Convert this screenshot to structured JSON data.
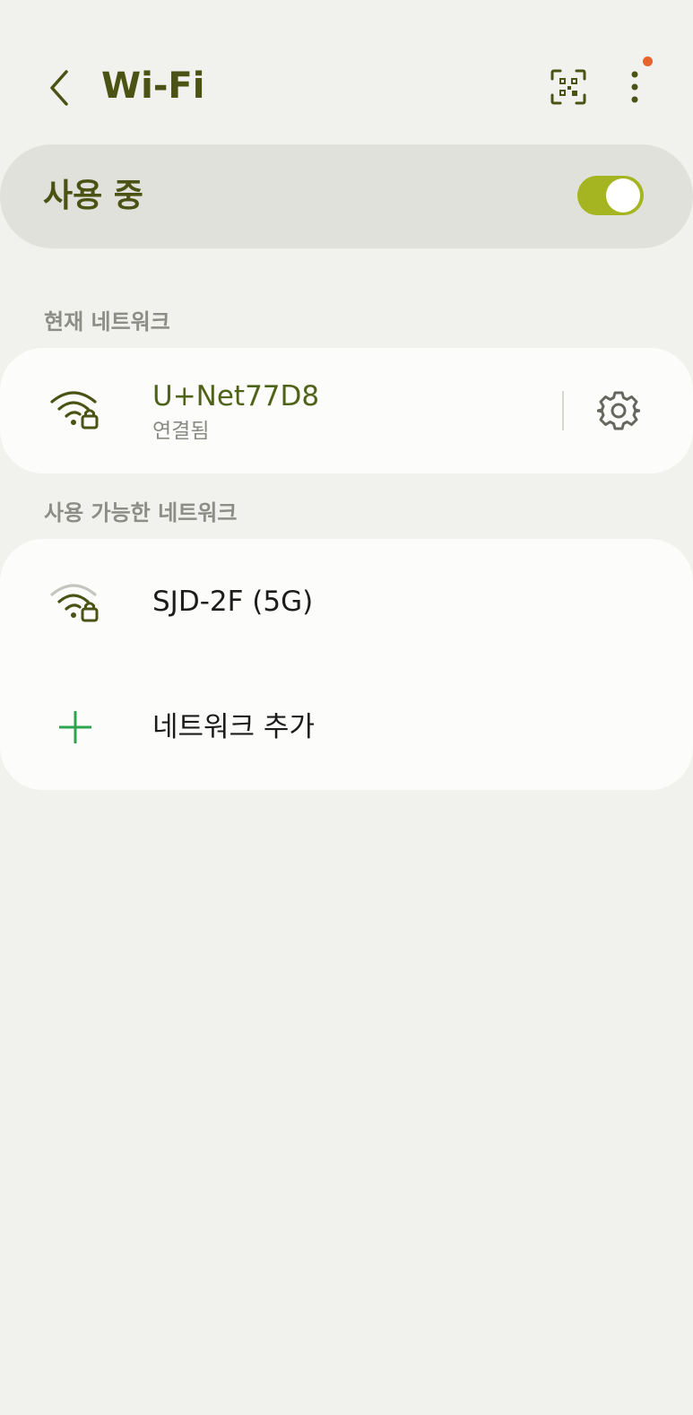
{
  "header": {
    "title": "Wi-Fi",
    "back_icon": "chevron-left-icon",
    "qr_icon": "qr-code-scan-icon",
    "more_icon": "more-vertical-icon",
    "notification_dot_color": "#e8622c"
  },
  "master_switch": {
    "label": "사용 중",
    "state": "on",
    "accent_color": "#a5b521"
  },
  "current_network": {
    "section_label": "현재 네트워크",
    "name": "U+Net77D8",
    "status": "연결됨",
    "icon": "wifi-locked-icon",
    "settings_icon": "gear-icon"
  },
  "available_networks": {
    "section_label": "사용 가능한 네트워크",
    "items": [
      {
        "name": "SJD-2F (5G)",
        "icon": "wifi-locked-icon"
      }
    ],
    "add_label": "네트워크 추가",
    "add_icon": "plus-icon"
  },
  "colors": {
    "title": "#4a5214",
    "background": "#f1f1ed",
    "card": "#fcfcfb",
    "add_plus": "#2ea44f"
  }
}
